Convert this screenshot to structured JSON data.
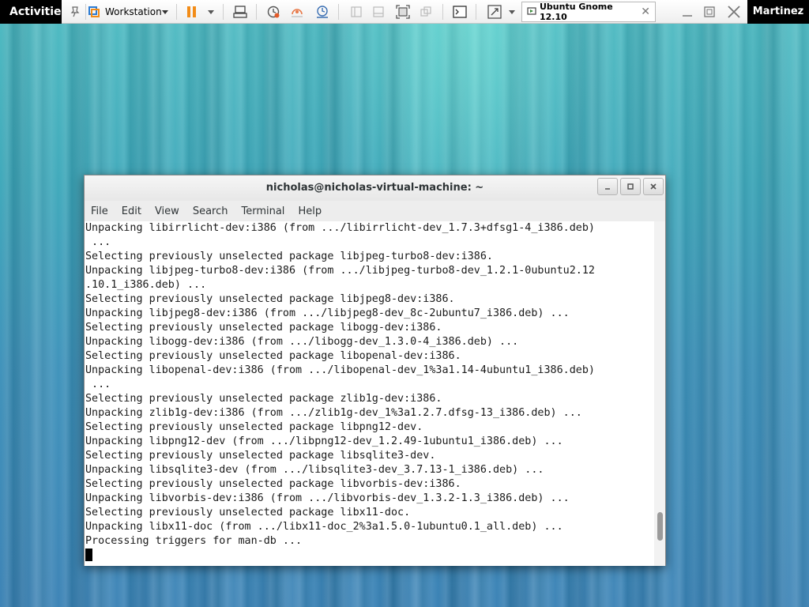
{
  "topbar": {
    "activities": "Activities",
    "user": "Martinez"
  },
  "vmware": {
    "workstation_label": "Workstation",
    "tab_title": "Ubuntu Gnome 12.10",
    "icons": [
      "pin-icon",
      "workstation-logo-icon",
      "dropdown-icon",
      "pause-icon",
      "send-keys-icon",
      "snapshot-icon",
      "revert-snapshot-icon",
      "snapshot-manager-icon",
      "console-view-icon",
      "quick-switch-icon",
      "fullscreen-icon",
      "unity-icon",
      "terminal-console-icon",
      "stretch-icon",
      "tab-vm-icon",
      "minimize-icon",
      "restore-icon",
      "close-icon"
    ]
  },
  "terminal": {
    "title": "nicholas@nicholas-virtual-machine: ~",
    "menu": [
      "File",
      "Edit",
      "View",
      "Search",
      "Terminal",
      "Help"
    ],
    "lines": [
      "Unpacking libirrlicht-dev:i386 (from .../libirrlicht-dev_1.7.3+dfsg1-4_i386.deb)",
      " ...",
      "Selecting previously unselected package libjpeg-turbo8-dev:i386.",
      "Unpacking libjpeg-turbo8-dev:i386 (from .../libjpeg-turbo8-dev_1.2.1-0ubuntu2.12",
      ".10.1_i386.deb) ...",
      "Selecting previously unselected package libjpeg8-dev:i386.",
      "Unpacking libjpeg8-dev:i386 (from .../libjpeg8-dev_8c-2ubuntu7_i386.deb) ...",
      "Selecting previously unselected package libogg-dev:i386.",
      "Unpacking libogg-dev:i386 (from .../libogg-dev_1.3.0-4_i386.deb) ...",
      "Selecting previously unselected package libopenal-dev:i386.",
      "Unpacking libopenal-dev:i386 (from .../libopenal-dev_1%3a1.14-4ubuntu1_i386.deb)",
      " ...",
      "Selecting previously unselected package zlib1g-dev:i386.",
      "Unpacking zlib1g-dev:i386 (from .../zlib1g-dev_1%3a1.2.7.dfsg-13_i386.deb) ...",
      "Selecting previously unselected package libpng12-dev.",
      "Unpacking libpng12-dev (from .../libpng12-dev_1.2.49-1ubuntu1_i386.deb) ...",
      "Selecting previously unselected package libsqlite3-dev.",
      "Unpacking libsqlite3-dev (from .../libsqlite3-dev_3.7.13-1_i386.deb) ...",
      "Selecting previously unselected package libvorbis-dev:i386.",
      "Unpacking libvorbis-dev:i386 (from .../libvorbis-dev_1.3.2-1.3_i386.deb) ...",
      "Selecting previously unselected package libx11-doc.",
      "Unpacking libx11-doc (from .../libx11-doc_2%3a1.5.0-1ubuntu0.1_all.deb) ...",
      "Processing triggers for man-db ..."
    ],
    "scroll_position": 0.93
  }
}
